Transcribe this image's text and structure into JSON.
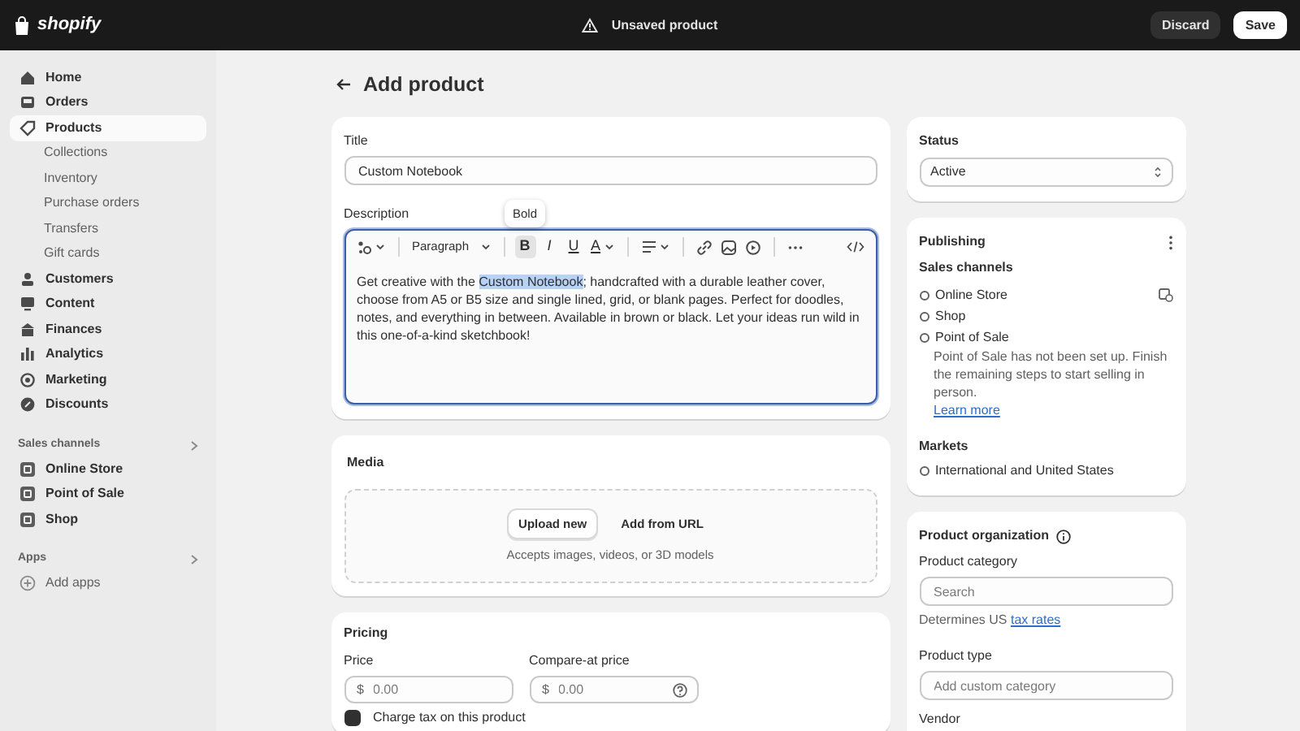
{
  "topbar": {
    "logo": "shopify",
    "notice": "Unsaved product",
    "buttons": [
      {
        "label": "Discard",
        "kind": "secondary"
      },
      {
        "label": "Save",
        "kind": "primary"
      }
    ]
  },
  "sidebar": {
    "items": [
      {
        "label": "Home",
        "selected": false
      },
      {
        "label": "Orders",
        "selected": false
      },
      {
        "label": "Products",
        "selected": true,
        "children": [
          {
            "label": "Collections"
          },
          {
            "label": "Inventory"
          },
          {
            "label": "Purchase orders"
          },
          {
            "label": "Transfers"
          },
          {
            "label": "Gift cards"
          }
        ]
      },
      {
        "label": "Customers",
        "selected": false
      },
      {
        "label": "Content",
        "selected": false
      },
      {
        "label": "Finances",
        "selected": false
      },
      {
        "label": "Analytics",
        "selected": false
      },
      {
        "label": "Marketing",
        "selected": false
      },
      {
        "label": "Discounts",
        "selected": false
      }
    ],
    "sections": [
      {
        "title": "Sales channels",
        "items": [
          {
            "label": "Online Store"
          },
          {
            "label": "Point of Sale"
          },
          {
            "label": "Shop"
          }
        ]
      },
      {
        "title": "Apps",
        "items": [
          {
            "label": "Add apps"
          }
        ]
      }
    ]
  },
  "page": {
    "title": "Add product"
  },
  "product": {
    "title_label": "Title",
    "title_value": "Custom Notebook",
    "description_label": "Description",
    "toolbar": {
      "format": "Paragraph",
      "tooltip": "Bold",
      "buttons": [
        {
          "label": "B",
          "active": true
        },
        {
          "label": "I",
          "active": false
        },
        {
          "label": "U",
          "active": false
        },
        {
          "label": "A",
          "active": false
        }
      ]
    },
    "description_before": "Get creative with the ",
    "description_selected": "Custom Notebook",
    "description_after": "; handcrafted with a durable leather cover, choose from A5 or B5 size and single lined, grid, or blank pages. Perfect for doodles, notes, and everything in between. Available in brown or black. Let your ideas run wild in this one-of-a-kind sketchbook!"
  },
  "media": {
    "title": "Media",
    "upload_button": "Upload new",
    "url_button": "Add from URL",
    "hint": "Accepts images, videos, or 3D models"
  },
  "pricing": {
    "title": "Pricing",
    "fields": [
      {
        "label": "Price",
        "prefix": "$",
        "placeholder": "0.00",
        "help": false
      },
      {
        "label": "Compare-at price",
        "prefix": "$",
        "placeholder": "0.00",
        "help": true
      }
    ],
    "tax": {
      "label": "Charge tax on this product",
      "checked": true
    }
  },
  "status": {
    "title": "Status",
    "value": "Active"
  },
  "publishing": {
    "title": "Publishing",
    "channels_label": "Sales channels",
    "channels": [
      {
        "name": "Online Store"
      },
      {
        "name": "Shop"
      },
      {
        "name": "Point of Sale",
        "note": "Point of Sale has not been set up. Finish the remaining steps to start selling in person.",
        "link": "Learn more"
      }
    ],
    "markets_label": "Markets",
    "markets": [
      "International and United States"
    ]
  },
  "organization": {
    "title": "Product organization",
    "category_label": "Product category",
    "category_placeholder": "Search",
    "hint": "Determines US ",
    "hint_link": "tax rates",
    "type_label": "Product type",
    "type_placeholder": "Add custom category",
    "vendor_label": "Vendor"
  }
}
